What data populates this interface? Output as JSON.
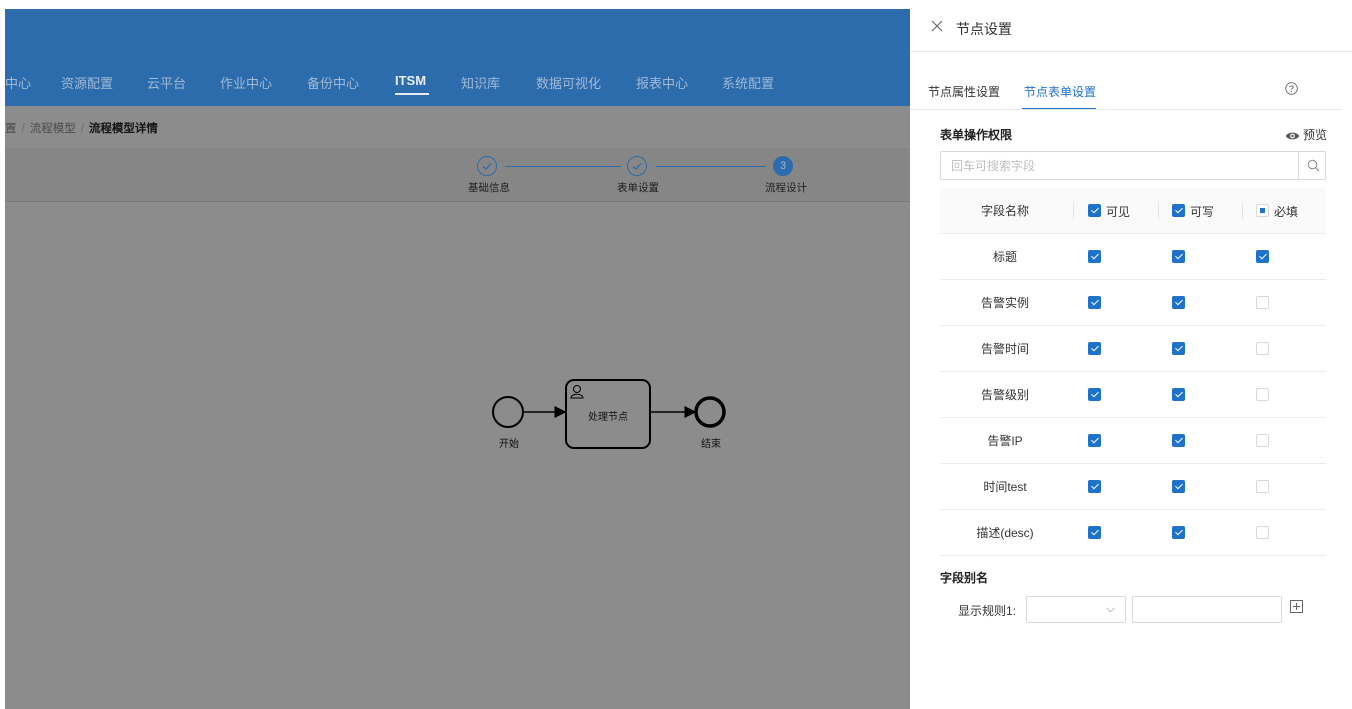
{
  "nav": {
    "items": [
      {
        "label": "中心"
      },
      {
        "label": "资源配置"
      },
      {
        "label": "云平台"
      },
      {
        "label": "作业中心"
      },
      {
        "label": "备份中心"
      },
      {
        "label": "ITSM"
      },
      {
        "label": "知识库"
      },
      {
        "label": "数据可视化"
      },
      {
        "label": "报表中心"
      },
      {
        "label": "系统配置"
      }
    ],
    "active": "ITSM"
  },
  "breadcrumb": {
    "items": [
      "置",
      "流程模型"
    ],
    "current": "流程模型详情",
    "separator": "/"
  },
  "steps": [
    {
      "label": "基础信息",
      "status": "done"
    },
    {
      "label": "表单设置",
      "status": "done"
    },
    {
      "label": "流程设计",
      "status": "current",
      "number": "3"
    }
  ],
  "diagram": {
    "start_label": "开始",
    "task_label": "处理节点",
    "end_label": "结束"
  },
  "drawer": {
    "title": "节点设置",
    "tabs": [
      {
        "label": "节点属性设置",
        "active": false
      },
      {
        "label": "节点表单设置",
        "active": true
      }
    ],
    "permissions_title": "表单操作权限",
    "preview_label": "预览",
    "search_placeholder": "回车可搜索字段",
    "table": {
      "header": {
        "name": "字段名称",
        "visible": "可见",
        "writable": "可写",
        "required": "必填",
        "visible_state": "checked",
        "writable_state": "checked",
        "required_state": "indeterminate"
      },
      "rows": [
        {
          "name": "标题",
          "visible": true,
          "writable": true,
          "required": true
        },
        {
          "name": "告警实例",
          "visible": true,
          "writable": true,
          "required": false
        },
        {
          "name": "告警时间",
          "visible": true,
          "writable": true,
          "required": false
        },
        {
          "name": "告警级别",
          "visible": true,
          "writable": true,
          "required": false
        },
        {
          "name": "告警IP",
          "visible": true,
          "writable": true,
          "required": false
        },
        {
          "name": "时间test",
          "visible": true,
          "writable": true,
          "required": false
        },
        {
          "name": "描述(desc)",
          "visible": true,
          "writable": true,
          "required": false
        }
      ]
    },
    "alias_title": "字段别名",
    "rule_label": "显示规则1:",
    "rule_select_value": "",
    "rule_input_value": ""
  },
  "colors": {
    "nav_bg": "#2d6cac",
    "accent": "#1f72c9",
    "overlay_bg": "#8c8c8c"
  }
}
